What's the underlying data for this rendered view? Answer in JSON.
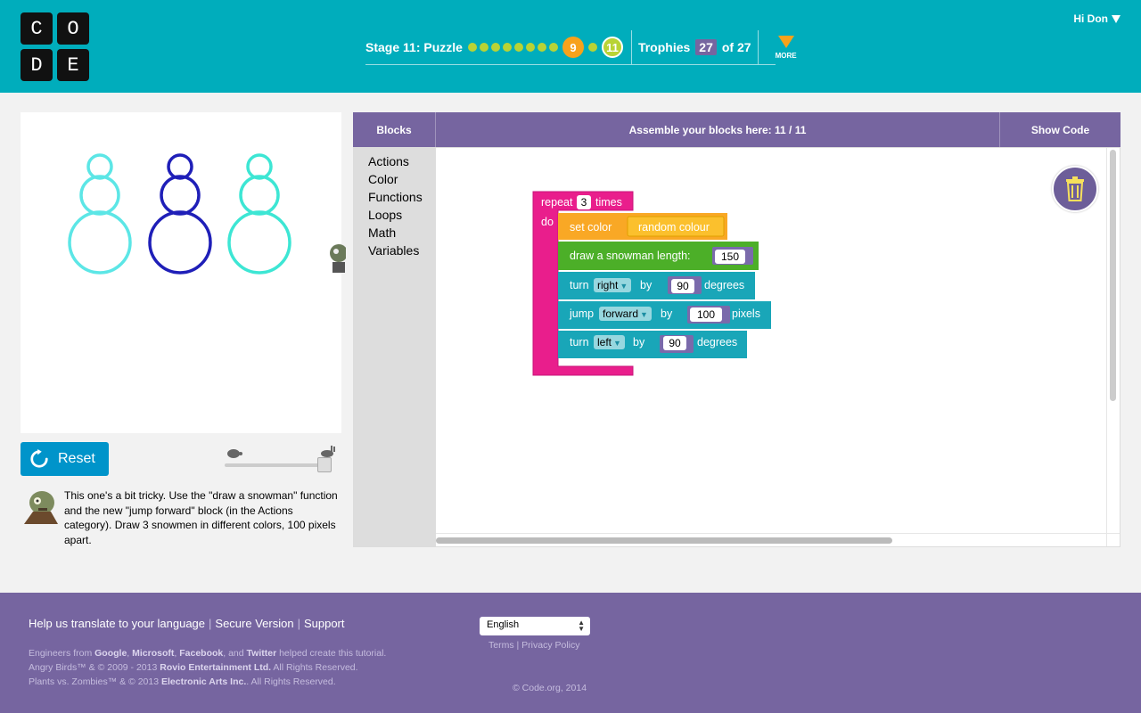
{
  "header": {
    "logo_letters": [
      "C",
      "O",
      "D",
      "E"
    ],
    "stage_label": "Stage 11: Puzzle",
    "completed_puzzles": 8,
    "current_puzzle": "9",
    "last_puzzle": "11",
    "trophies_label": "Trophies",
    "trophies_count": "27",
    "trophies_total": "of 27",
    "more_label": "MORE",
    "user_greeting": "Hi Don",
    "brand_color": "#00adbc",
    "accent_color": "#7665a0"
  },
  "visualization": {
    "snowman_colors": [
      "#5ce6e6",
      "#1f1fb8",
      "#3de6d4"
    ]
  },
  "controls": {
    "reset_label": "Reset",
    "speed_level": 0.9
  },
  "instructions": {
    "text": "This one's a bit tricky. Use the \"draw a snowman\" function and the new \"jump forward\" block (in the Actions category). Draw 3 snowmen in different colors, 100 pixels apart."
  },
  "workspace": {
    "blocks_tab": "Blocks",
    "assemble_label": "Assemble your blocks here: 11 / 11",
    "show_code": "Show Code",
    "toolbox": [
      "Actions",
      "Color",
      "Functions",
      "Loops",
      "Math",
      "Variables"
    ]
  },
  "program": {
    "repeat_label": "repeat",
    "repeat_count": "3",
    "times_label": "times",
    "do_label": "do",
    "set_color_label": "set color",
    "random_colour_label": "random colour",
    "draw_snowman_label": "draw a snowman  length:",
    "snowman_length": "150",
    "turn1_label": "turn",
    "turn1_dir": "right",
    "by_label": "by",
    "turn1_value": "90",
    "degrees_label": "degrees",
    "jump_label": "jump",
    "jump_dir": "forward",
    "jump_value": "100",
    "pixels_label": "pixels",
    "turn2_label": "turn",
    "turn2_dir": "left",
    "turn2_value": "90"
  },
  "footer": {
    "link_translate": "Help us translate to your language",
    "link_secure": "Secure Version",
    "link_support": "Support",
    "credits_line1_prefix": "Engineers from ",
    "credits_google": "Google",
    "credits_microsoft": "Microsoft",
    "credits_facebook": "Facebook",
    "credits_and": ", and ",
    "credits_twitter": "Twitter",
    "credits_line1_suffix": " helped create this tutorial.",
    "credits_line2_prefix": "Angry Birds™ & © 2009 - 2013 ",
    "credits_rovio": "Rovio Entertainment Ltd.",
    "credits_line2_suffix": " All Rights Reserved.",
    "credits_line3_prefix": "Plants vs. Zombies™ & © 2013 ",
    "credits_ea": "Electronic Arts Inc.",
    "credits_line3_suffix": ". All Rights Reserved.",
    "language": "English",
    "terms": "Terms",
    "privacy": "Privacy Policy",
    "copyright": "© Code.org, 2014"
  }
}
